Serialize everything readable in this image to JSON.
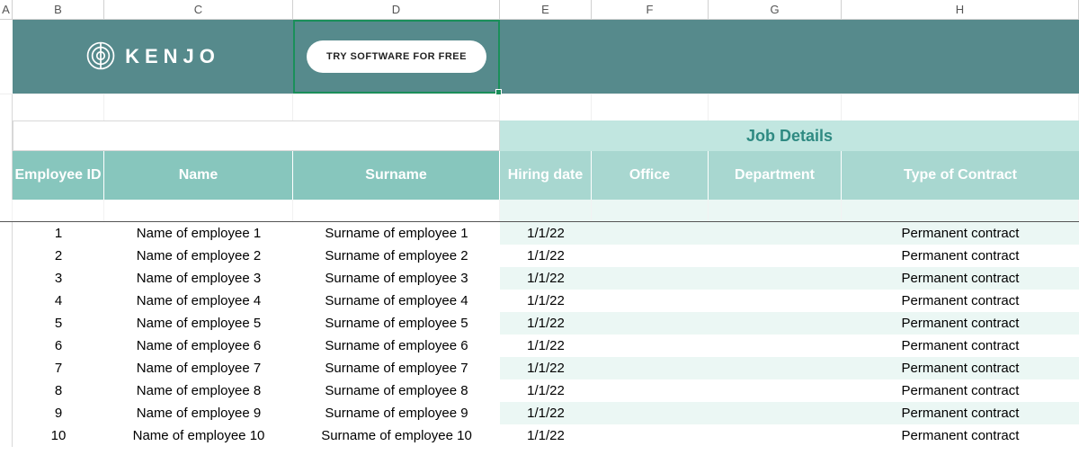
{
  "columns": [
    "A",
    "B",
    "C",
    "D",
    "E",
    "F",
    "G",
    "H"
  ],
  "logo_text": "KENJO",
  "try_button_label": "TRY SOFTWARE FOR FREE",
  "section_title": "Job Details",
  "headers": {
    "employee_id": "Employee ID",
    "name": "Name",
    "surname": "Surname",
    "hiring_date": "Hiring date",
    "office": "Office",
    "department": "Department",
    "contract": "Type of Contract"
  },
  "rows": [
    {
      "id": "1",
      "name": "Name of employee 1",
      "surname": "Surname of employee 1",
      "hiring": "1/1/22",
      "office": "",
      "department": "",
      "contract": "Permanent contract"
    },
    {
      "id": "2",
      "name": "Name of employee 2",
      "surname": "Surname of employee 2",
      "hiring": "1/1/22",
      "office": "",
      "department": "",
      "contract": "Permanent contract"
    },
    {
      "id": "3",
      "name": "Name of employee 3",
      "surname": "Surname of employee 3",
      "hiring": "1/1/22",
      "office": "",
      "department": "",
      "contract": "Permanent contract"
    },
    {
      "id": "4",
      "name": "Name of employee 4",
      "surname": "Surname of employee 4",
      "hiring": "1/1/22",
      "office": "",
      "department": "",
      "contract": "Permanent contract"
    },
    {
      "id": "5",
      "name": "Name of employee 5",
      "surname": "Surname of employee 5",
      "hiring": "1/1/22",
      "office": "",
      "department": "",
      "contract": "Permanent contract"
    },
    {
      "id": "6",
      "name": "Name of employee 6",
      "surname": "Surname of employee 6",
      "hiring": "1/1/22",
      "office": "",
      "department": "",
      "contract": "Permanent contract"
    },
    {
      "id": "7",
      "name": "Name of employee 7",
      "surname": "Surname of employee 7",
      "hiring": "1/1/22",
      "office": "",
      "department": "",
      "contract": "Permanent contract"
    },
    {
      "id": "8",
      "name": "Name of employee 8",
      "surname": "Surname of employee 8",
      "hiring": "1/1/22",
      "office": "",
      "department": "",
      "contract": "Permanent contract"
    },
    {
      "id": "9",
      "name": "Name of employee 9",
      "surname": "Surname of employee 9",
      "hiring": "1/1/22",
      "office": "",
      "department": "",
      "contract": "Permanent contract"
    },
    {
      "id": "10",
      "name": "Name of employee 10",
      "surname": "Surname of employee 10",
      "hiring": "1/1/22",
      "office": "",
      "department": "",
      "contract": "Permanent contract"
    }
  ]
}
